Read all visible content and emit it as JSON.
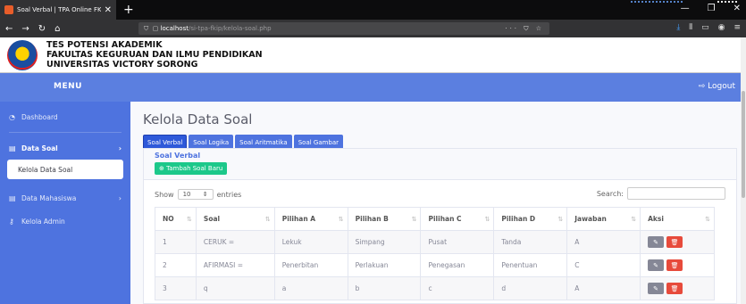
{
  "browser": {
    "tab_title": "Soal Verbal | TPA Online FKIP U",
    "tab_close": "✕",
    "new_tab": "+",
    "url_host": "localhost",
    "url_path": "/si-tpa-fkip/kelola-soal.php"
  },
  "header": {
    "line1": "TES POTENSI AKADEMIK",
    "line2": "FAKULTAS KEGURUAN DAN ILMU PENDIDIKAN",
    "line3": "UNIVERSITAS VICTORY SORONG"
  },
  "topbar": {
    "menu": "MENU",
    "logout": "Logout"
  },
  "sidebar": {
    "items": [
      {
        "label": "Dashboard"
      },
      {
        "label": "Data Soal"
      },
      {
        "label": "Kelola Data Soal"
      },
      {
        "label": "Data Mahasiswa"
      },
      {
        "label": "Kelola Admin"
      }
    ]
  },
  "main": {
    "title": "Kelola Data Soal",
    "tabs": [
      {
        "label": "Soal Verbal"
      },
      {
        "label": "Soal Logika"
      },
      {
        "label": "Soal Aritmatika"
      },
      {
        "label": "Soal Gambar"
      }
    ],
    "card_title": "Soal Verbal",
    "add_button": "Tambah Soal Baru",
    "show_label": "Show",
    "entries_value": "10",
    "entries_label": "entries",
    "search_label": "Search:"
  },
  "table": {
    "headers": [
      "NO",
      "Soal",
      "Pilihan A",
      "Pilihan B",
      "Pilihan C",
      "Pilihan D",
      "Jawaban",
      "Aksi"
    ],
    "rows": [
      [
        "1",
        "CERUK =",
        "Lekuk",
        "Simpang",
        "Pusat",
        "Tanda",
        "A"
      ],
      [
        "2",
        "AFIRMASI =",
        "Penerbitan",
        "Perlakuan",
        "Penegasan",
        "Penentuan",
        "C"
      ],
      [
        "3",
        "q",
        "a",
        "b",
        "c",
        "d",
        "A"
      ]
    ]
  }
}
